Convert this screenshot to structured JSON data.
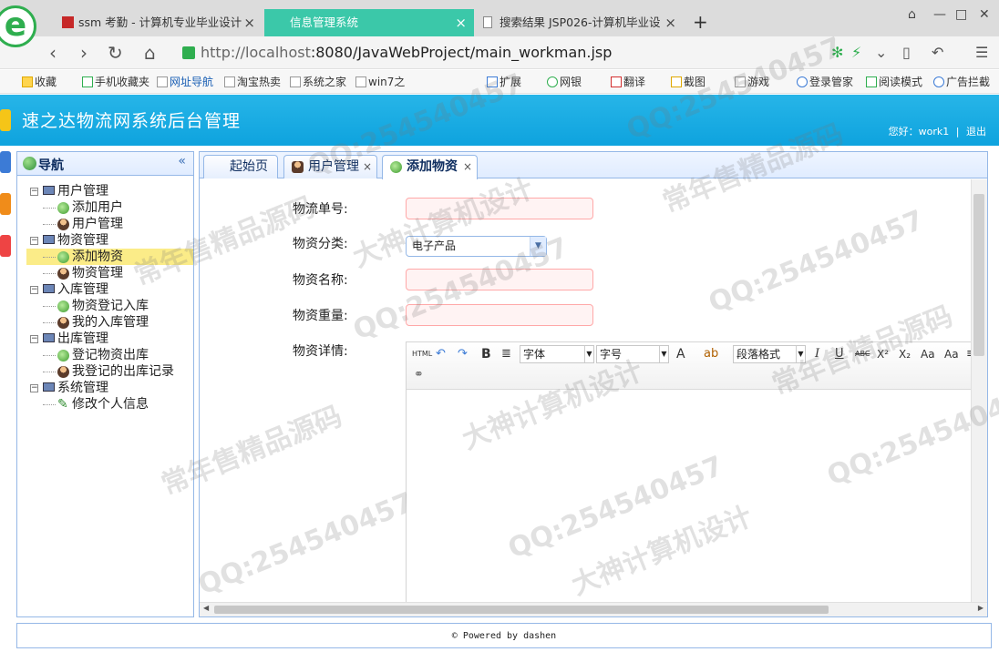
{
  "browser": {
    "tabs": [
      {
        "title": "ssm 考勤 - 计算机专业毕业设计",
        "close": "×"
      },
      {
        "title": "信息管理系统",
        "close": "×"
      },
      {
        "title": "搜索结果 JSP026-计算机毕业设",
        "close": "×"
      }
    ],
    "new_tab": "+",
    "url_host": "http://localhost",
    "url_rest": ":8080/JavaWebProject/main_workman.jsp",
    "bookmarks": [
      "收藏",
      "手机收藏夹",
      "网址导航",
      "淘宝热卖",
      "系统之家",
      "win7之",
      "扩展",
      "网银",
      "翻译",
      "截图",
      "游戏",
      "登录管家",
      "阅读模式",
      "广告拦截"
    ]
  },
  "app": {
    "title": "速之达物流网系统后台管理",
    "greeting": "您好：work1",
    "separator": "|",
    "logout": "退出"
  },
  "sidebar": {
    "title": "导航",
    "collapse": "«",
    "groups": [
      {
        "label": "用户管理",
        "children": [
          {
            "label": "添加用户",
            "icon": "add-icon"
          },
          {
            "label": "用户管理",
            "icon": "user-icon"
          }
        ]
      },
      {
        "label": "物资管理",
        "children": [
          {
            "label": "添加物资",
            "icon": "add-icon"
          },
          {
            "label": "物资管理",
            "icon": "user-icon"
          }
        ]
      },
      {
        "label": "入库管理",
        "children": [
          {
            "label": "物资登记入库",
            "icon": "add-icon"
          },
          {
            "label": "我的入库管理",
            "icon": "user-icon"
          }
        ]
      },
      {
        "label": "出库管理",
        "children": [
          {
            "label": "登记物资出库",
            "icon": "add-icon"
          },
          {
            "label": "我登记的出库记录",
            "icon": "user-icon"
          }
        ]
      },
      {
        "label": "系统管理",
        "children": [
          {
            "label": "修改个人信息",
            "icon": "pencil-icon"
          }
        ]
      }
    ]
  },
  "tabs": [
    {
      "label": "起始页"
    },
    {
      "label": "用户管理",
      "close": "×"
    },
    {
      "label": "添加物资",
      "close": "×"
    }
  ],
  "form": {
    "tracking_no_label": "物流单号:",
    "tracking_no_value": "",
    "category_label": "物资分类:",
    "category_value": "电子产品",
    "name_label": "物资名称:",
    "name_value": "",
    "weight_label": "物资重量:",
    "weight_value": "",
    "details_label": "物资详情:"
  },
  "editor_toolbar": {
    "html": "HTML",
    "bold": "B",
    "font": "字体",
    "size": "字号",
    "color": "A",
    "paragraph": "段落格式",
    "italic": "I",
    "underline": "U",
    "strike": "ABC",
    "sup": "X²",
    "sub": "X₂"
  },
  "footer": "© Powered by dashen",
  "watermarks": [
    "QQ:254540457",
    "常年售精品源码",
    "大神计算机设计"
  ],
  "colors": {
    "header": "#0ea3de",
    "accent_border": "#95b8e7",
    "selected": "#fbec88",
    "invalid_field": "#ffa8a8"
  }
}
